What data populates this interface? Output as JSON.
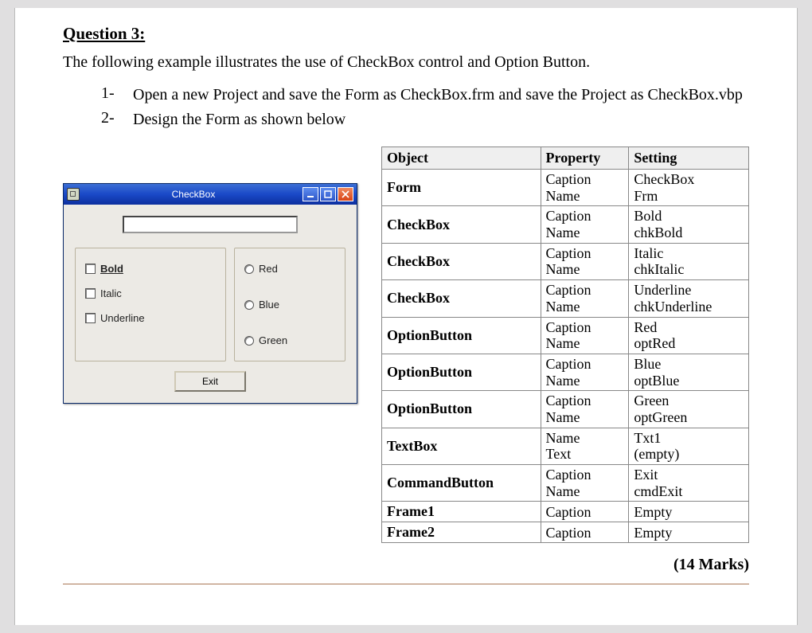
{
  "question_title": "Question 3:",
  "intro": "The following example illustrates the use of CheckBox control and Option Button.",
  "steps": [
    {
      "num": "1-",
      "text": "Open a new Project and save the Form as CheckBox.frm and save the Project as CheckBox.vbp"
    },
    {
      "num": "2-",
      "text": "Design the Form as shown below"
    }
  ],
  "form": {
    "title": "CheckBox",
    "checkboxes": [
      {
        "label": "Bold"
      },
      {
        "label": "Italic"
      },
      {
        "label": "Underline"
      }
    ],
    "options": [
      {
        "label": "Red"
      },
      {
        "label": "Blue"
      },
      {
        "label": "Green"
      }
    ],
    "exit_label": "Exit"
  },
  "table": {
    "headers": [
      "Object",
      "Property",
      "Setting"
    ],
    "rows": [
      {
        "object": "Form",
        "props": [
          "Caption",
          "Name"
        ],
        "settings": [
          "CheckBox",
          "Frm"
        ]
      },
      {
        "object": "CheckBox",
        "props": [
          "Caption",
          "Name"
        ],
        "settings": [
          "Bold",
          "chkBold"
        ]
      },
      {
        "object": "CheckBox",
        "props": [
          "Caption",
          "Name"
        ],
        "settings": [
          "Italic",
          "chkItalic"
        ]
      },
      {
        "object": "CheckBox",
        "props": [
          "Caption",
          "Name"
        ],
        "settings": [
          "Underline",
          "chkUnderline"
        ]
      },
      {
        "object": "OptionButton",
        "props": [
          "Caption",
          "Name"
        ],
        "settings": [
          "Red",
          "optRed"
        ]
      },
      {
        "object": "OptionButton",
        "props": [
          "Caption",
          "Name"
        ],
        "settings": [
          "Blue",
          "optBlue"
        ]
      },
      {
        "object": "OptionButton",
        "props": [
          "Caption",
          "Name"
        ],
        "settings": [
          "Green",
          "optGreen"
        ]
      },
      {
        "object": "TextBox",
        "props": [
          "Name",
          "Text"
        ],
        "settings": [
          "Txt1",
          "(empty)"
        ]
      },
      {
        "object": "CommandButton",
        "props": [
          "Caption",
          "Name"
        ],
        "settings": [
          "Exit",
          "cmdExit"
        ]
      },
      {
        "object": "Frame1",
        "props": [
          "Caption"
        ],
        "settings": [
          "Empty"
        ]
      },
      {
        "object": "Frame2",
        "props": [
          "Caption"
        ],
        "settings": [
          "Empty"
        ]
      }
    ]
  },
  "marks": "(14 Marks)"
}
